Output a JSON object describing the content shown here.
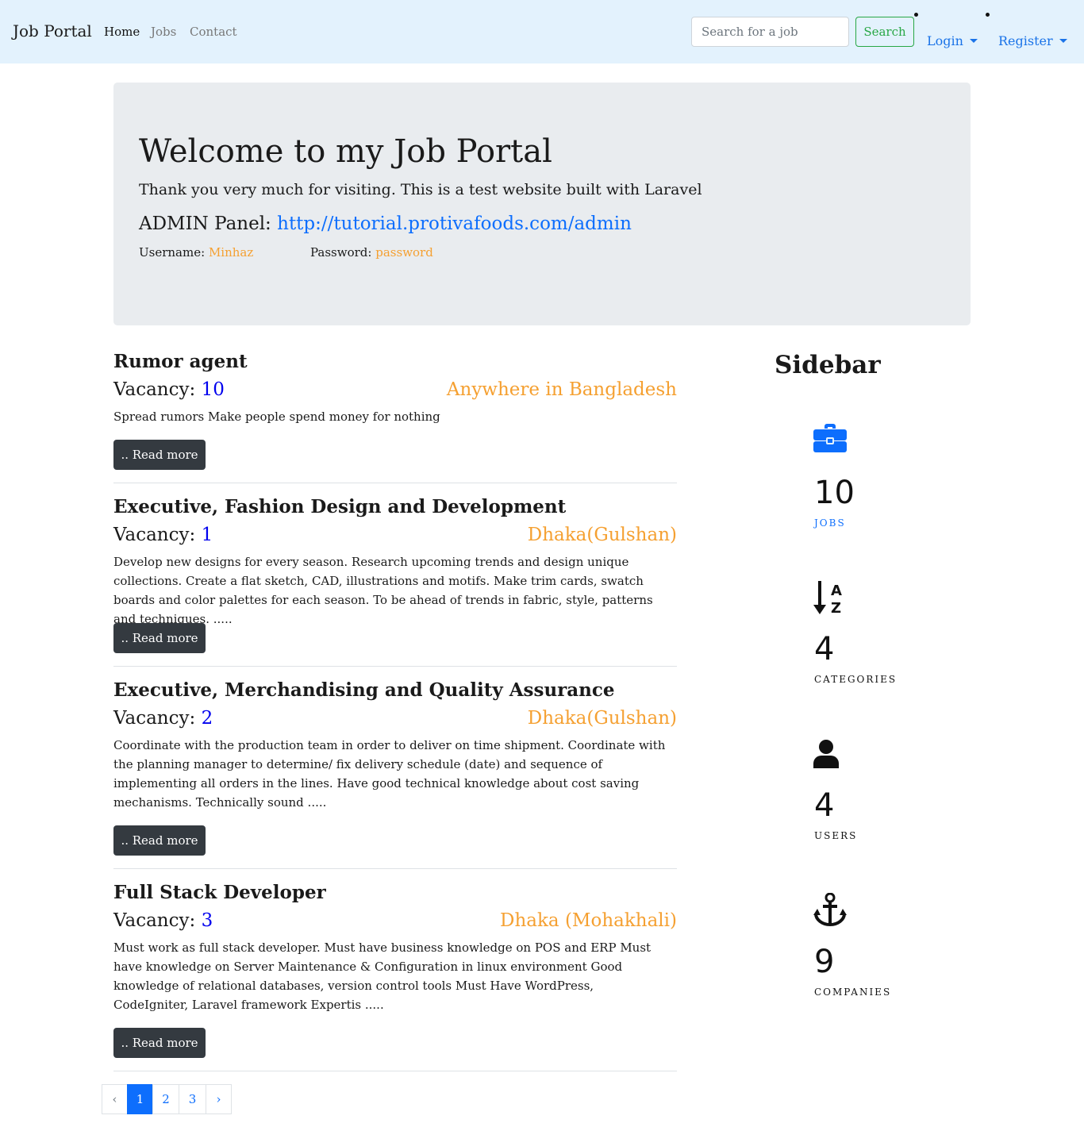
{
  "navbar": {
    "brand": "Job Portal",
    "links": [
      "Home",
      "Jobs",
      "Contact"
    ],
    "search_placeholder": "Search for a job",
    "search_label": "Search",
    "login_label": "Login",
    "register_label": "Register"
  },
  "jumbotron": {
    "heading": "Welcome to my Job Portal",
    "lead": "Thank you very much for visiting. This is a test website built with Laravel",
    "admin_label": "ADMIN Panel:",
    "admin_url": "http://tutorial.protivafoods.com/admin",
    "username_label": "Username:",
    "username_value": "Minhaz",
    "password_label": "Password:",
    "password_value": "password"
  },
  "jobs": [
    {
      "title": "Rumor agent",
      "vacancy_label": "Vacancy:",
      "vacancy": "10",
      "location": "Anywhere in Bangladesh",
      "description": "Spread rumors Make people spend money for nothing",
      "read_more": ".. Read more"
    },
    {
      "title": "Executive, Fashion Design and Development",
      "vacancy_label": "Vacancy:",
      "vacancy": "1",
      "location": "Dhaka(Gulshan)",
      "description": "Develop new designs for every season. Research upcoming trends and design unique collections. Create a flat sketch, CAD, illustrations and motifs. Make trim cards, swatch boards and color palettes for each season. To be ahead of trends in fabric, style, patterns and techniques.   .....",
      "read_more": ".. Read more"
    },
    {
      "title": "Executive, Merchandising and Quality Assurance",
      "vacancy_label": "Vacancy:",
      "vacancy": "2",
      "location": "Dhaka(Gulshan)",
      "description": "Coordinate with the production team in order to deliver on time shipment. Coordinate with the planning manager to determine/ fix delivery schedule (date) and sequence of implementing all orders in the lines. Have good technical knowledge about cost saving mechanisms. Technically sound   .....",
      "read_more": ".. Read more"
    },
    {
      "title": "Full Stack Developer",
      "vacancy_label": "Vacancy:",
      "vacancy": "3",
      "location": "Dhaka (Mohakhali)",
      "description": "Must work as full stack developer. Must have business knowledge on POS and ERP Must have knowledge on Server Maintenance & Configuration in linux environment Good knowledge of relational databases, version control tools Must Have WordPress, CodeIgniter, Laravel framework Expertis   .....",
      "read_more": ".. Read more"
    }
  ],
  "pagination": {
    "prev": "‹",
    "pages": [
      "1",
      "2",
      "3"
    ],
    "next": "›",
    "current": "1"
  },
  "sidebar": {
    "title": "Sidebar",
    "stats": [
      {
        "icon": "briefcase-icon",
        "value": "10",
        "label": "JOBS",
        "color": "#0d6efd"
      },
      {
        "icon": "sort-alpha-down-icon",
        "value": "4",
        "label": "CATEGORIES",
        "color": "#111111"
      },
      {
        "icon": "user-icon",
        "value": "4",
        "label": "USERS",
        "color": "#111111"
      },
      {
        "icon": "anchor-icon",
        "value": "9",
        "label": "COMPANIES",
        "color": "#111111"
      }
    ]
  },
  "colors": {
    "navbar_bg": "#e3f2fd",
    "jumbotron_bg": "#e9ecef",
    "accent_blue": "#0d6efd",
    "location_orange": "#f5a031",
    "success_green": "#28a745",
    "dark_button": "#343a40"
  }
}
